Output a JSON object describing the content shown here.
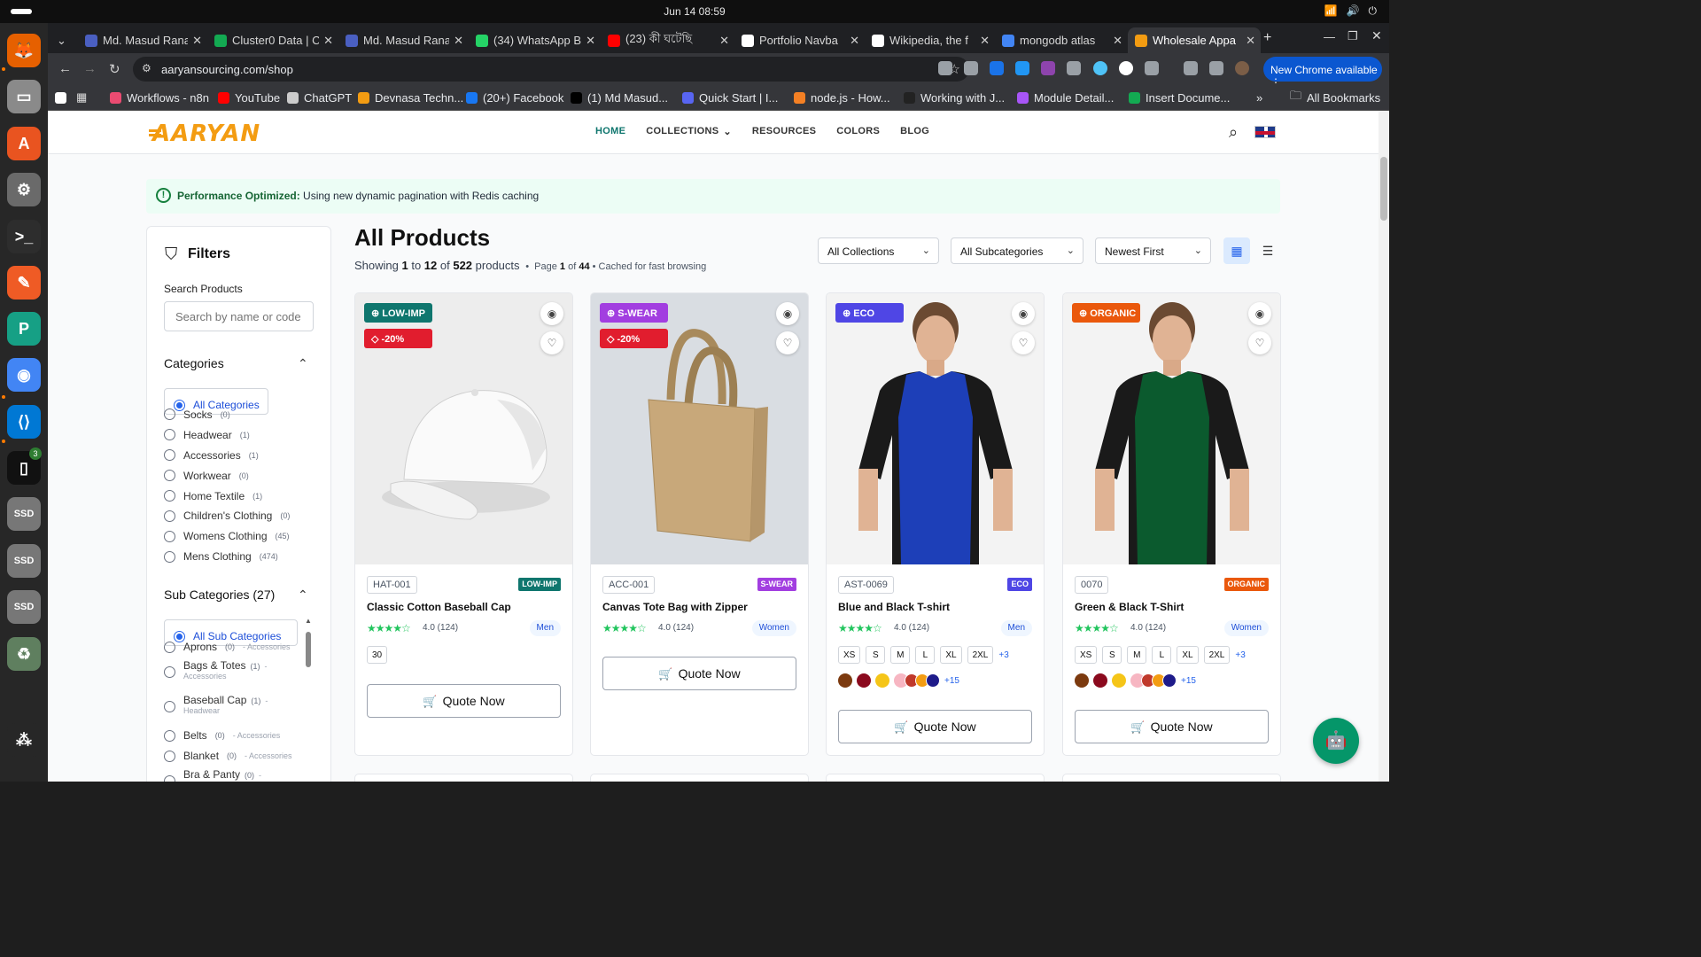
{
  "os": {
    "clock": "Jun 14  08:59",
    "dock": [
      {
        "name": "firefox-icon",
        "color": "#e66000",
        "glyph": "🦊"
      },
      {
        "name": "files-icon",
        "color": "#8a8a8a",
        "glyph": "▭"
      },
      {
        "name": "software-icon",
        "color": "#e95420",
        "glyph": "A"
      },
      {
        "name": "settings-icon",
        "color": "#6a6a6a",
        "glyph": "⚙"
      },
      {
        "name": "terminal-icon",
        "color": "#2d2d2d",
        "glyph": ">_"
      },
      {
        "name": "postman-icon",
        "color": "#ef5b25",
        "glyph": "✎"
      },
      {
        "name": "pycharm-icon",
        "color": "#16a085",
        "glyph": "P"
      },
      {
        "name": "chrome-icon",
        "color": "#4285f4",
        "glyph": "◉"
      },
      {
        "name": "vscode-icon",
        "color": "#0078d4",
        "glyph": "⟨⟩"
      },
      {
        "name": "notes-icon",
        "color": "#111111",
        "glyph": "▯"
      },
      {
        "name": "ssd-icon",
        "color": "#777777",
        "glyph": "SSD"
      },
      {
        "name": "ssd-icon",
        "color": "#777777",
        "glyph": "SSD"
      },
      {
        "name": "ssd-icon",
        "color": "#777777",
        "glyph": "SSD"
      },
      {
        "name": "trash-icon",
        "color": "#5f7f5f",
        "glyph": "♻"
      },
      {
        "name": "apps-grid-icon",
        "color": "#272727",
        "glyph": "⁂"
      }
    ],
    "notes_badge": "3"
  },
  "browser": {
    "tabs": [
      {
        "title": "Md. Masud Rana",
        "icon_color": "#4a5fc1"
      },
      {
        "title": "Cluster0 Data | C",
        "icon_color": "#13aa52"
      },
      {
        "title": "Md. Masud Rana",
        "icon_color": "#4a5fc1"
      },
      {
        "title": "(34) WhatsApp B",
        "icon_color": "#25d366"
      },
      {
        "title": "(23) কী ঘটেছি",
        "icon_color": "#ff0000"
      },
      {
        "title": "Portfolio Navba",
        "icon_color": "#ffffff"
      },
      {
        "title": "Wikipedia, the f",
        "icon_color": "#ffffff"
      },
      {
        "title": "mongodb atlas",
        "icon_color": "#4285f4"
      },
      {
        "title": "Wholesale Appa",
        "icon_color": "#f39c12"
      }
    ],
    "url": "aaryansourcing.com/shop",
    "new_chrome": "New Chrome available",
    "bookmarks": [
      {
        "label": "Workflows - n8n",
        "color": "#ea4b71"
      },
      {
        "label": "YouTube",
        "color": "#ff0000"
      },
      {
        "label": "ChatGPT",
        "color": "#cccccc"
      },
      {
        "label": "Devnasa Techn...",
        "color": "#f39c12"
      },
      {
        "label": "(20+) Facebook",
        "color": "#1877f2"
      },
      {
        "label": "(1) Md Masud...",
        "color": "#000000"
      },
      {
        "label": "Quick Start | I...",
        "color": "#5865f2"
      },
      {
        "label": "node.js - How...",
        "color": "#f48024"
      },
      {
        "label": "Working with J...",
        "color": "#222222"
      },
      {
        "label": "Module Detail...",
        "color": "#a855f7"
      },
      {
        "label": "Insert Docume...",
        "color": "#13aa52"
      }
    ],
    "all_bookmarks": "All Bookmarks"
  },
  "site": {
    "logo": "AARYAN",
    "nav": [
      "HOME",
      "COLLECTIONS",
      "RESOURCES",
      "COLORS",
      "BLOG"
    ],
    "alert_bold": "Performance Optimized:",
    "alert_text": " Using new dynamic pagination with Redis caching",
    "filters": {
      "title": "Filters",
      "search_label": "Search Products",
      "search_placeholder": "Search by name or code",
      "categories_title": "Categories",
      "categories": [
        {
          "label": "All Categories",
          "count": "",
          "selected": true
        },
        {
          "label": "Socks",
          "count": "(0)"
        },
        {
          "label": "Headwear",
          "count": "(1)"
        },
        {
          "label": "Accessories",
          "count": "(1)"
        },
        {
          "label": "Workwear",
          "count": "(0)"
        },
        {
          "label": "Home Textile",
          "count": "(1)"
        },
        {
          "label": "Children's Clothing",
          "count": "(0)"
        },
        {
          "label": "Womens Clothing",
          "count": "(45)"
        },
        {
          "label": "Mens Clothing",
          "count": "(474)"
        }
      ],
      "subcategories_title": "Sub Categories (27)",
      "subcategories": [
        {
          "label": "All Sub Categories",
          "count": "",
          "parent": "",
          "selected": true
        },
        {
          "label": "Aprons",
          "count": "(0)",
          "parent": "- Accessories"
        },
        {
          "label": "Bags & Totes",
          "count": "(1)",
          "parent": "- Accessories"
        },
        {
          "label": "Baseball Cap",
          "count": "(1)",
          "parent": "- Headwear"
        },
        {
          "label": "Belts",
          "count": "(0)",
          "parent": "- Accessories"
        },
        {
          "label": "Blanket",
          "count": "(0)",
          "parent": "- Accessories"
        },
        {
          "label": "Bra & Panty",
          "count": "(0)",
          "parent": "-"
        }
      ]
    },
    "main": {
      "title": "All Products",
      "showing_pre": "Showing ",
      "from": "1",
      "to": "12",
      "total": "522",
      "page": "1",
      "pages": "44",
      "cached": "Cached for fast browsing",
      "selects": [
        "All Collections",
        "All Subcategories",
        "Newest First"
      ]
    },
    "products": [
      {
        "badge": "LOW-IMP",
        "badge_color": "#0f766e",
        "discount": "-20%",
        "code": "HAT-001",
        "name": "Classic Cotton Baseball Cap",
        "rating": "4.0 (124)",
        "gender": "Men",
        "sizes": [
          "30"
        ],
        "more_sizes": "",
        "colors": [],
        "more_colors": "",
        "quote": "Quote Now",
        "image": "cap"
      },
      {
        "badge": "S-WEAR",
        "badge_color": "#a23ee0",
        "discount": "-20%",
        "code": "ACC-001",
        "name": "Canvas Tote Bag with Zipper",
        "rating": "4.0 (124)",
        "gender": "Women",
        "sizes": [],
        "more_sizes": "",
        "colors": [],
        "more_colors": "",
        "quote": "Quote Now",
        "image": "bag"
      },
      {
        "badge": "ECO",
        "badge_color": "#4f46e5",
        "discount": "",
        "code": "AST-0069",
        "name": "Blue and Black T-shirt",
        "rating": "4.0 (124)",
        "gender": "Men",
        "sizes": [
          "XS",
          "S",
          "M",
          "L",
          "XL",
          "2XL"
        ],
        "more_sizes": "+3",
        "colors": [
          "#7c3a0f",
          "#8b0a1e",
          "#f5c518",
          "#f7b6c2",
          "#c0392b",
          "#f39c12",
          "#1e1b8a"
        ],
        "more_colors": "+15",
        "quote": "Quote Now",
        "image": "tshirt",
        "shirt_color": "#1d3fb8"
      },
      {
        "badge": "ORGANIC",
        "badge_color": "#ea580c",
        "discount": "",
        "code": "0070",
        "name": "Green & Black T-Shirt",
        "rating": "4.0 (124)",
        "gender": "Women",
        "sizes": [
          "XS",
          "S",
          "M",
          "L",
          "XL",
          "2XL"
        ],
        "more_sizes": "+3",
        "colors": [
          "#7c3a0f",
          "#8b0a1e",
          "#f5c518",
          "#f7b6c2",
          "#c0392b",
          "#f39c12",
          "#1e1b8a"
        ],
        "more_colors": "+15",
        "quote": "Quote Now",
        "image": "tshirt",
        "shirt_color": "#0b5a2e"
      }
    ]
  }
}
